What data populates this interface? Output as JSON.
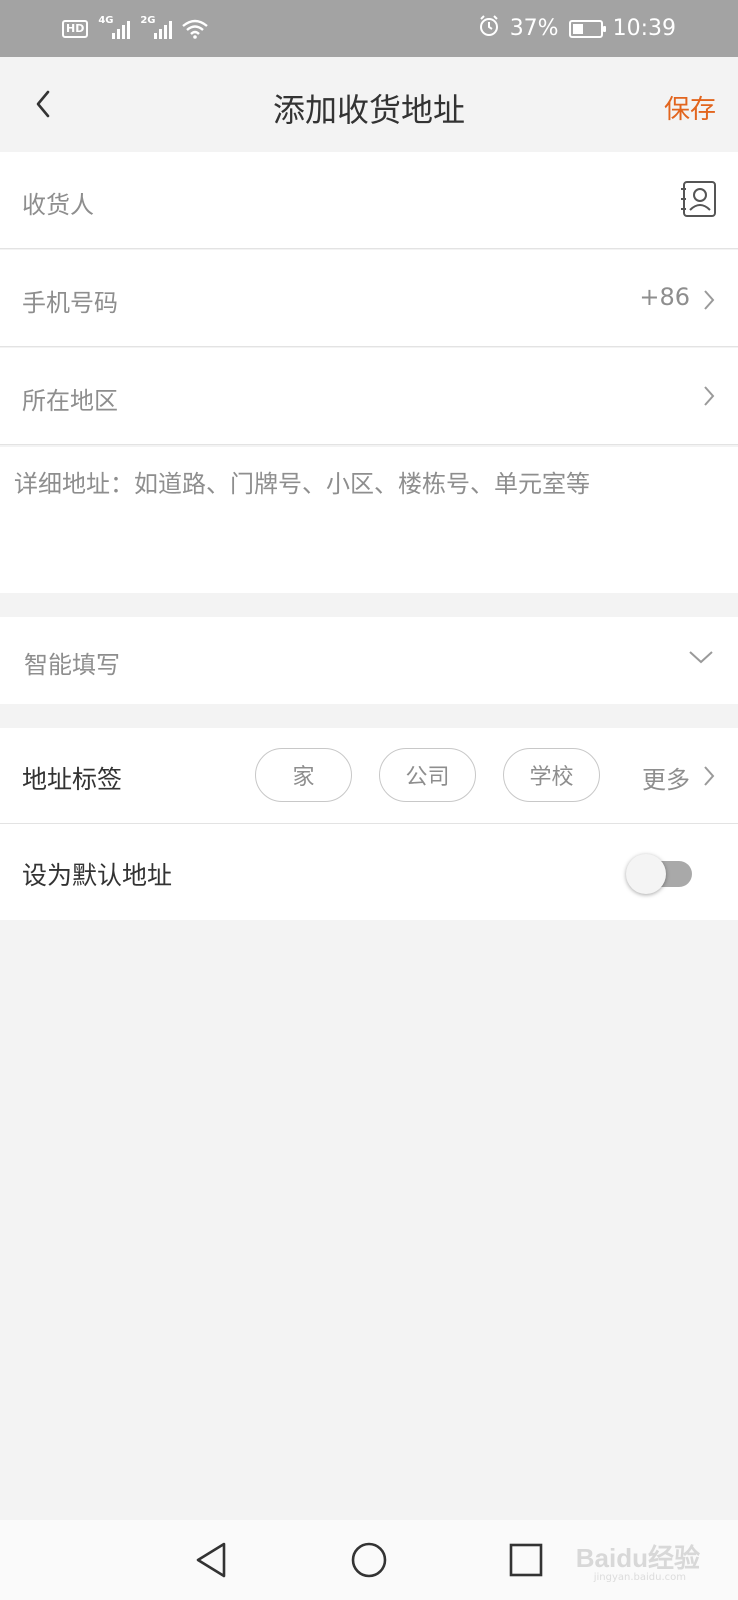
{
  "status_bar": {
    "hd_label": "HD",
    "net1": "4G",
    "net2": "2G",
    "battery_percent": "37%",
    "battery_level": 0.37,
    "time": "10:39"
  },
  "navbar": {
    "title": "添加收货地址",
    "save_label": "保存",
    "accent_color": "#e2651e"
  },
  "form": {
    "recipient_placeholder": "收货人",
    "phone_placeholder": "手机号码",
    "phone_prefix": "+86",
    "region_placeholder": "所在地区",
    "address_placeholder": "详细地址：如道路、门牌号、小区、楼栋号、单元室等"
  },
  "smart_fill": {
    "label": "智能填写"
  },
  "address_tags": {
    "label": "地址标签",
    "tags": [
      "家",
      "公司",
      "学校"
    ],
    "more_label": "更多"
  },
  "default_address": {
    "label": "设为默认地址",
    "enabled": false
  },
  "watermark": {
    "text": "Baidu经验",
    "sub": "jingyan.baidu.com"
  }
}
